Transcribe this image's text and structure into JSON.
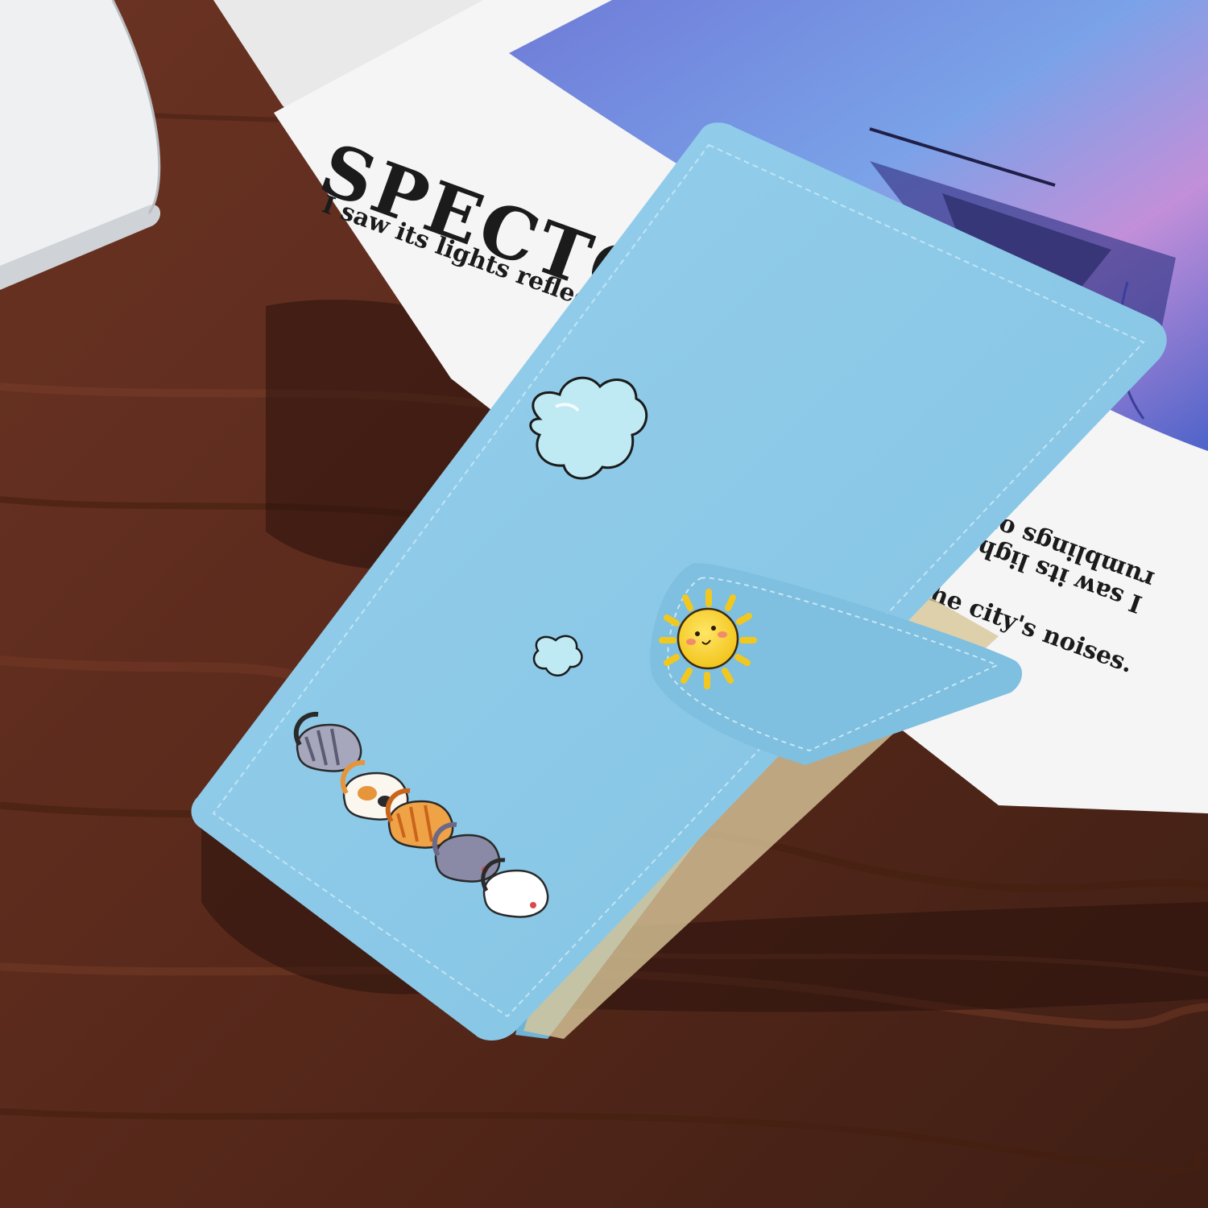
{
  "book": {
    "title": "SPECTOR",
    "line_front": "I saw its lights reflected i",
    "line_back_1": "I saw its lights r",
    "line_back_2": "rumblings of the",
    "line_back_3": "the city's noises."
  },
  "colors": {
    "wood": "#5a2b1d",
    "wood_dark": "#3a1d14",
    "case_blue": "#8fcbe8",
    "case_blue_dark": "#6eb3d6",
    "book_white": "#f4f4f4",
    "sun": "#f6d52c"
  },
  "icons": {
    "cloud": "cloud-icon",
    "sun": "sun-icon",
    "cats": "cat-icon"
  }
}
